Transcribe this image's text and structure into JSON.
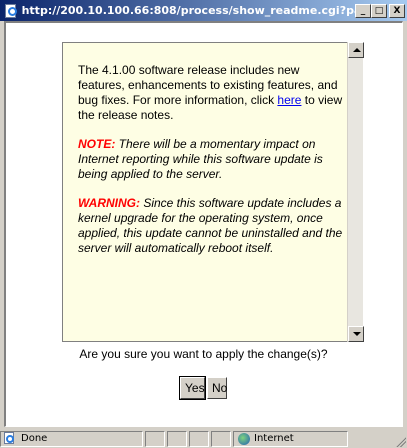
{
  "window": {
    "title": "http://200.10.100.66:808/process/show_readme.cgi?pa...",
    "buttons": {
      "minimize": "_",
      "maximize": "□",
      "close": "X"
    }
  },
  "readme": {
    "intro_before_link": "The 4.1.00 software release includes new features, enhancements to existing features, and bug fixes. For more information, click ",
    "link_text": "here",
    "intro_after_link": " to view the release notes.",
    "note_label": "NOTE:",
    "note_text": " There will be a momentary impact on Internet reporting while this software update is being applied to the server.",
    "warning_label": "WARNING:",
    "warning_text": " Since this software update includes a kernel upgrade for the operating system, once applied, this update cannot be uninstalled and the server will automatically reboot itself."
  },
  "dialog": {
    "question": "Are you sure you want to apply the change(s)?",
    "yes_label": "Yes",
    "no_label": "No"
  },
  "statusbar": {
    "status_text": "Done",
    "zone_text": "Internet"
  },
  "colors": {
    "readme_background": "#fefee4",
    "note_color": "#ff0000",
    "link_color": "#0000ee",
    "titlebar_start": "#0a246a",
    "titlebar_end": "#a6caf0"
  },
  "icons": {
    "title_icon": "ie-page-icon",
    "status_icon": "ie-page-icon",
    "zone_icon": "globe-icon"
  }
}
